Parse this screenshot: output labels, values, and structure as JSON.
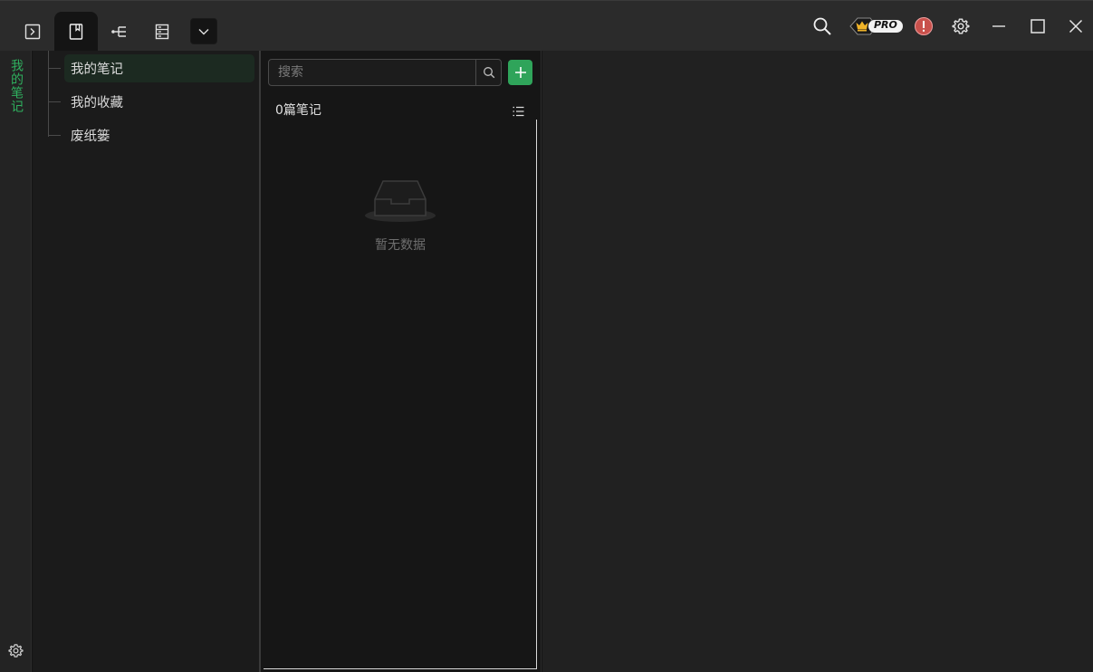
{
  "toolbar": {
    "tabs": [
      {
        "name": "terminal",
        "icon": "terminal-box-icon"
      },
      {
        "name": "notes",
        "icon": "notebook-icon",
        "active": true
      },
      {
        "name": "tree",
        "icon": "tree-structure-icon"
      },
      {
        "name": "storage",
        "icon": "server-rack-icon"
      }
    ],
    "dropdown_icon": "chevron-down-icon",
    "pro_label": "PRO",
    "icons": [
      "search-icon",
      "pro-badge-icon",
      "alert-icon",
      "gear-icon",
      "minimize-icon",
      "maximize-icon",
      "close-icon"
    ]
  },
  "activity_bar": {
    "label": "我的笔记",
    "settings_icon": "gear-icon"
  },
  "tree": {
    "items": [
      {
        "label": "我的笔记",
        "selected": true
      },
      {
        "label": "我的收藏"
      },
      {
        "label": "废纸篓"
      }
    ]
  },
  "notelist": {
    "search_placeholder": "搜索",
    "count_label": "0篇笔记",
    "empty_text": "暂无数据"
  },
  "colors": {
    "accent": "#2fa45a",
    "accent_text": "#2fb15f",
    "alert": "#d9534f"
  }
}
